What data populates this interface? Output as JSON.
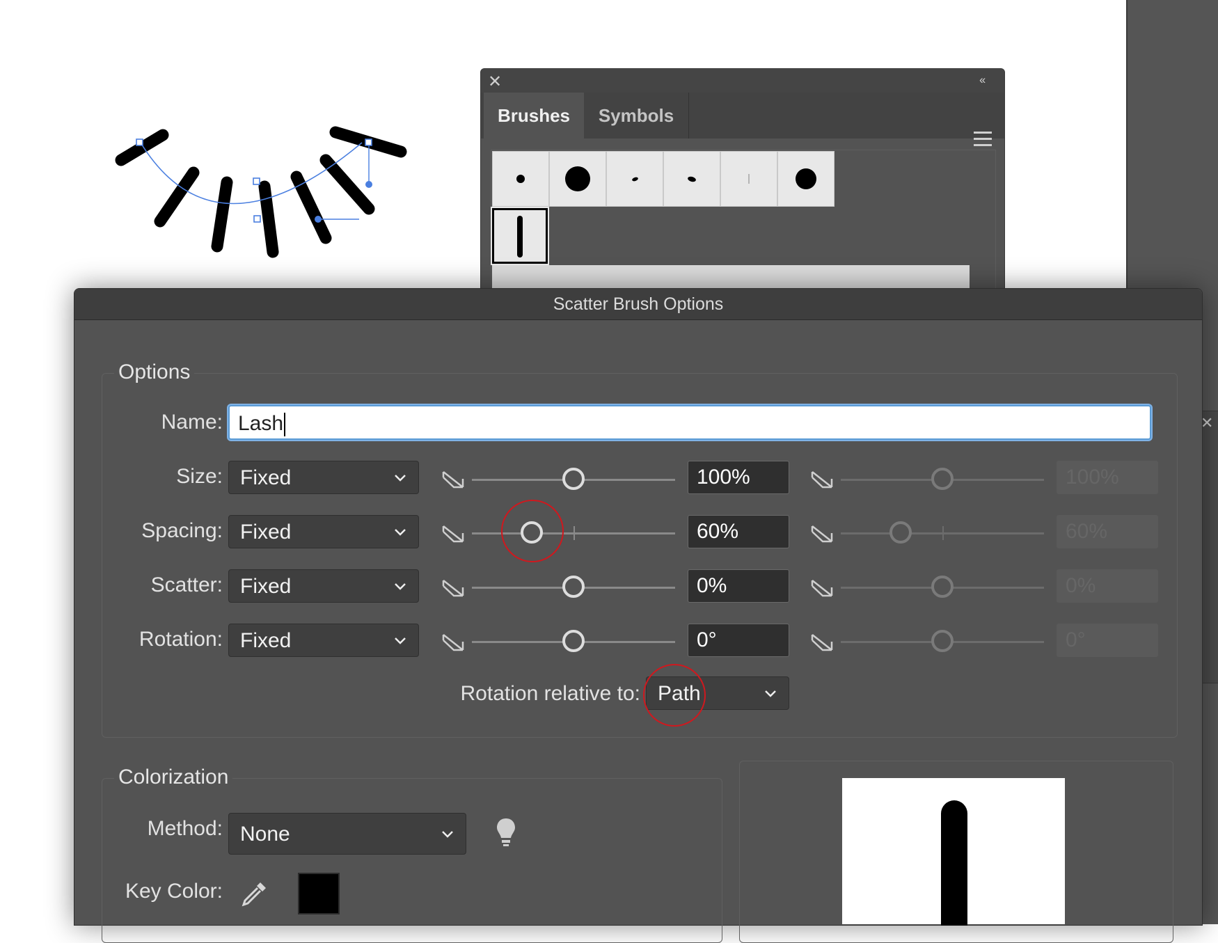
{
  "colors": {
    "panel_bg": "#535353",
    "accent_focus": "#5b9bd5",
    "annotation_circle": "#d0181e"
  },
  "brushes_panel": {
    "tabs": [
      {
        "label": "Brushes",
        "active": true
      },
      {
        "label": "Symbols",
        "active": false
      }
    ],
    "close_icon": "close-icon",
    "collapse_icon": "double-chevron-left-icon",
    "menu_icon": "hamburger-menu-icon"
  },
  "dialog": {
    "title": "Scatter Brush Options",
    "options": {
      "group_label": "Options",
      "name_label": "Name:",
      "name_value": "Lash",
      "rows": [
        {
          "label": "Size:",
          "mode": "Fixed",
          "value": "100%",
          "secondary_value": "100%",
          "level": 0.5
        },
        {
          "label": "Spacing:",
          "mode": "Fixed",
          "value": "60%",
          "secondary_value": "60%",
          "level": 0.3
        },
        {
          "label": "Scatter:",
          "mode": "Fixed",
          "value": "0%",
          "secondary_value": "0%",
          "level": 0.5
        },
        {
          "label": "Rotation:",
          "mode": "Fixed",
          "value": "0°",
          "secondary_value": "0°",
          "level": 0.5
        }
      ],
      "rotation_relative_label": "Rotation relative to:",
      "rotation_relative_value": "Path"
    },
    "colorization": {
      "group_label": "Colorization",
      "method_label": "Method:",
      "method_value": "None",
      "key_color_label": "Key Color:",
      "key_color": "#000000",
      "tips_icon": "lightbulb-icon",
      "eyedropper_icon": "eyedropper-icon"
    }
  }
}
